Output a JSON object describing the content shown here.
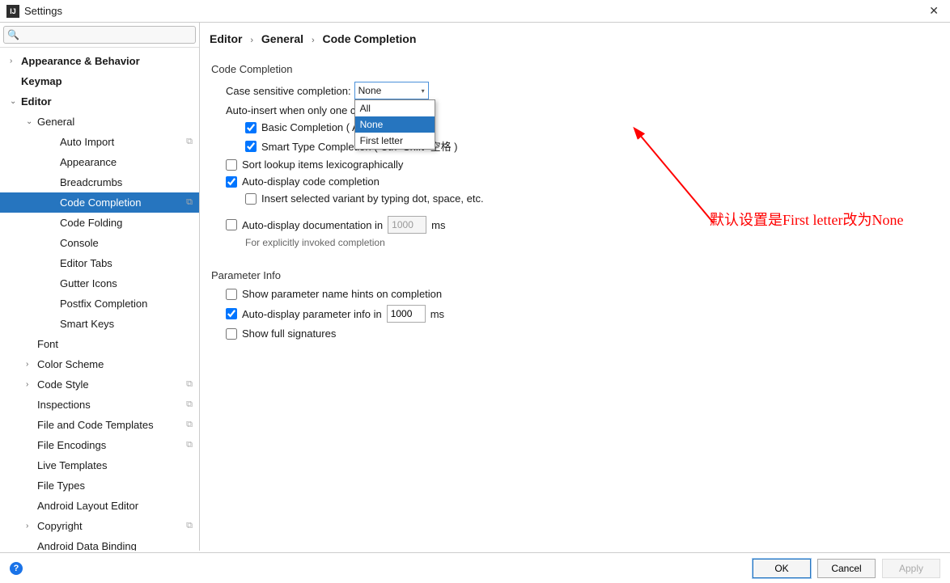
{
  "window": {
    "title": "Settings"
  },
  "search": {
    "placeholder": ""
  },
  "tree": [
    {
      "label": "Appearance & Behavior",
      "bold": true,
      "arrow": "›",
      "indent": 0,
      "copy": false
    },
    {
      "label": "Keymap",
      "bold": true,
      "arrow": "",
      "indent": 0,
      "copy": false
    },
    {
      "label": "Editor",
      "bold": true,
      "arrow": "⌄",
      "indent": 0,
      "copy": false
    },
    {
      "label": "General",
      "bold": false,
      "arrow": "⌄",
      "indent": 1,
      "copy": false
    },
    {
      "label": "Auto Import",
      "bold": false,
      "arrow": "",
      "indent": 3,
      "copy": true
    },
    {
      "label": "Appearance",
      "bold": false,
      "arrow": "",
      "indent": 3,
      "copy": false
    },
    {
      "label": "Breadcrumbs",
      "bold": false,
      "arrow": "",
      "indent": 3,
      "copy": false
    },
    {
      "label": "Code Completion",
      "bold": false,
      "arrow": "",
      "indent": 3,
      "copy": true,
      "selected": true
    },
    {
      "label": "Code Folding",
      "bold": false,
      "arrow": "",
      "indent": 3,
      "copy": false
    },
    {
      "label": "Console",
      "bold": false,
      "arrow": "",
      "indent": 3,
      "copy": false
    },
    {
      "label": "Editor Tabs",
      "bold": false,
      "arrow": "",
      "indent": 3,
      "copy": false
    },
    {
      "label": "Gutter Icons",
      "bold": false,
      "arrow": "",
      "indent": 3,
      "copy": false
    },
    {
      "label": "Postfix Completion",
      "bold": false,
      "arrow": "",
      "indent": 3,
      "copy": false
    },
    {
      "label": "Smart Keys",
      "bold": false,
      "arrow": "",
      "indent": 3,
      "copy": false
    },
    {
      "label": "Font",
      "bold": false,
      "arrow": "",
      "indent": 1,
      "copy": false
    },
    {
      "label": "Color Scheme",
      "bold": false,
      "arrow": "›",
      "indent": 1,
      "copy": false
    },
    {
      "label": "Code Style",
      "bold": false,
      "arrow": "›",
      "indent": 1,
      "copy": true
    },
    {
      "label": "Inspections",
      "bold": false,
      "arrow": "",
      "indent": 1,
      "copy": true
    },
    {
      "label": "File and Code Templates",
      "bold": false,
      "arrow": "",
      "indent": 1,
      "copy": true
    },
    {
      "label": "File Encodings",
      "bold": false,
      "arrow": "",
      "indent": 1,
      "copy": true
    },
    {
      "label": "Live Templates",
      "bold": false,
      "arrow": "",
      "indent": 1,
      "copy": false
    },
    {
      "label": "File Types",
      "bold": false,
      "arrow": "",
      "indent": 1,
      "copy": false
    },
    {
      "label": "Android Layout Editor",
      "bold": false,
      "arrow": "",
      "indent": 1,
      "copy": false
    },
    {
      "label": "Copyright",
      "bold": false,
      "arrow": "›",
      "indent": 1,
      "copy": true
    },
    {
      "label": "Android Data Binding",
      "bold": false,
      "arrow": "",
      "indent": 1,
      "copy": false
    }
  ],
  "breadcrumb": [
    "Editor",
    "General",
    "Code Completion"
  ],
  "sections": {
    "code_completion": {
      "title": "Code Completion",
      "case_label": "Case sensitive completion:",
      "case_value": "None",
      "case_options": [
        "All",
        "None",
        "First letter"
      ],
      "autoinsert_label": "Auto-insert when only one c",
      "basic": "Basic Completion ( A",
      "smart": "Smart Type Completion ( Ctrl+Shift+空格 )",
      "sort": "Sort lookup items lexicographically",
      "autodisplay": "Auto-display code completion",
      "insert_variant": "Insert selected variant by typing dot, space, etc.",
      "autodoc_label": "Auto-display documentation in",
      "autodoc_value": "1000",
      "ms": "ms",
      "autodoc_note": "For explicitly invoked completion"
    },
    "parameter_info": {
      "title": "Parameter Info",
      "hints": "Show parameter name hints on completion",
      "autoparam_label": "Auto-display parameter info in",
      "autoparam_value": "1000",
      "full_sig": "Show full signatures"
    }
  },
  "annotation": "默认设置是First letter改为None",
  "buttons": {
    "ok": "OK",
    "cancel": "Cancel",
    "apply": "Apply"
  }
}
